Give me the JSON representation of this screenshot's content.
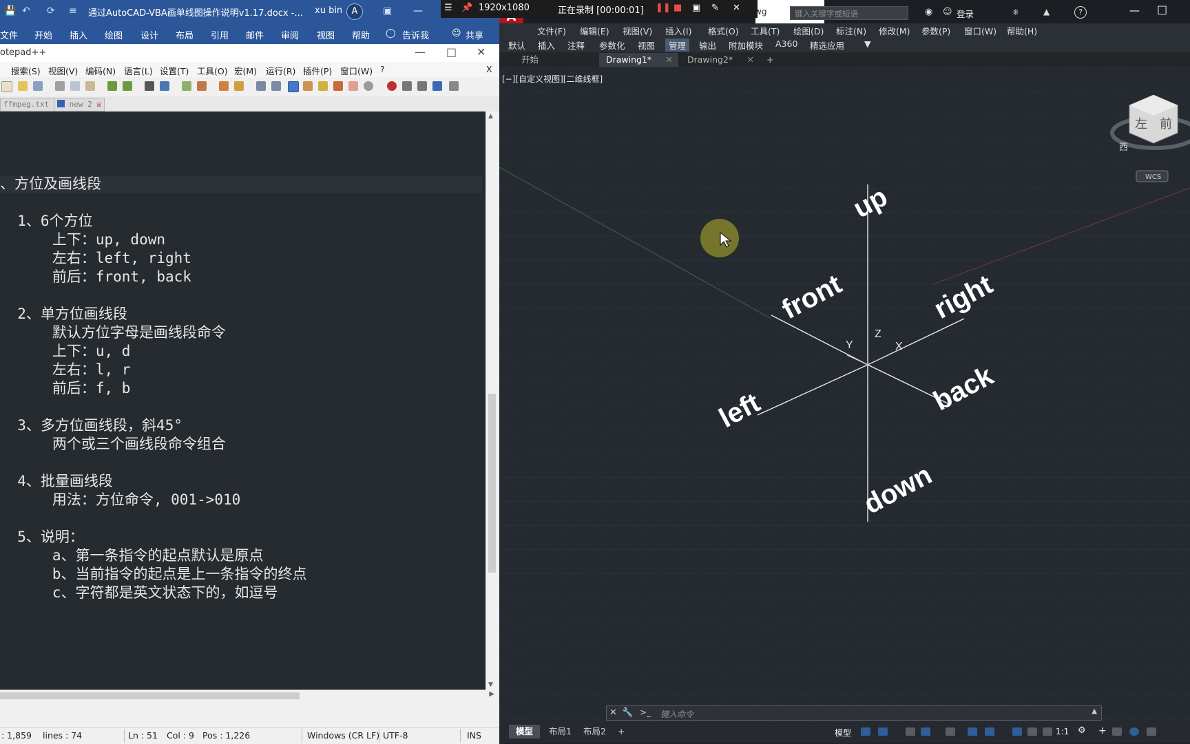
{
  "word": {
    "title": "通过AutoCAD-VBA画单线图操作说明v1.17.docx  -...",
    "user": "xu bin",
    "avatar": "A",
    "tabs": [
      "文件",
      "开始",
      "插入",
      "绘图",
      "设计",
      "布局",
      "引用",
      "邮件",
      "审阅",
      "视图",
      "帮助"
    ],
    "tell_me": "告诉我",
    "share": "共享"
  },
  "recorder": {
    "resolution": "1920x1080",
    "status": "正在录制 [00:00:01]"
  },
  "notepad": {
    "title": "otepad++",
    "menu": [
      "搜索(S)",
      "视图(V)",
      "编码(N)",
      "语言(L)",
      "设置(T)",
      "工具(O)",
      "宏(M)",
      "运行(R)",
      "插件(P)",
      "窗口(W)",
      "?"
    ],
    "close_x": "X",
    "tabs": [
      "ffmpeg.txt",
      "new 2"
    ],
    "lines": [
      "、方位及画线段",
      "",
      "  1、6个方位",
      "      上下：up, down",
      "      左右：left, right",
      "      前后：front, back",
      "",
      "  2、单方位画线段",
      "      默认方位字母是画线段命令",
      "      上下：u, d",
      "      左右：l, r",
      "      前后：f, b",
      "",
      "  3、多方位画线段，斜45°",
      "      两个或三个画线段命令组合",
      "",
      "  4、批量画线段",
      "      用法：方位命令, 001->010",
      "",
      "  5、说明：",
      "      a、第一条指令的起点默认是原点",
      "      b、当前指令的起点是上一条指令的终点",
      "      c、字符都是英文状态下的，如逗号"
    ],
    "status": {
      "length": ": 1,859",
      "lines": "lines : 74",
      "ln": "Ln : 51",
      "col": "Col : 9",
      "pos": "Pos : 1,226",
      "eol": "Windows (CR LF)",
      "encoding": "UTF-8",
      "mode": "INS"
    }
  },
  "autocad": {
    "logo": "A",
    "dwg_suffix": "wg",
    "search_placeholder": "键入关键字或短语",
    "login": "登录",
    "menu": [
      "文件(F)",
      "编辑(E)",
      "视图(V)",
      "插入(I)",
      "格式(O)",
      "工具(T)",
      "绘图(D)",
      "标注(N)",
      "修改(M)",
      "参数(P)",
      "窗口(W)",
      "帮助(H)"
    ],
    "ribbon_tabs": [
      "默认",
      "插入",
      "注释",
      "参数化",
      "视图",
      "管理",
      "输出",
      "附加模块",
      "A360",
      "精选应用"
    ],
    "ribbon_active": "管理",
    "doc_tabs": [
      "开始",
      "Drawing1*",
      "Drawing2*"
    ],
    "viewport_label": "[−][自定义视图][二维线框]",
    "axis_labels": {
      "up": "up",
      "down": "down",
      "front": "front",
      "back": "back",
      "left": "left",
      "right": "right",
      "x": "X",
      "y": "Y",
      "z": "Z"
    },
    "viewcube": {
      "face_left": "左",
      "face_front": "前",
      "compass_west": "西",
      "wcs": "WCS"
    },
    "command_placeholder": "键入命令",
    "layout_tabs": [
      "模型",
      "布局1",
      "布局2"
    ],
    "status_model": "模型",
    "scale": "1:1"
  }
}
